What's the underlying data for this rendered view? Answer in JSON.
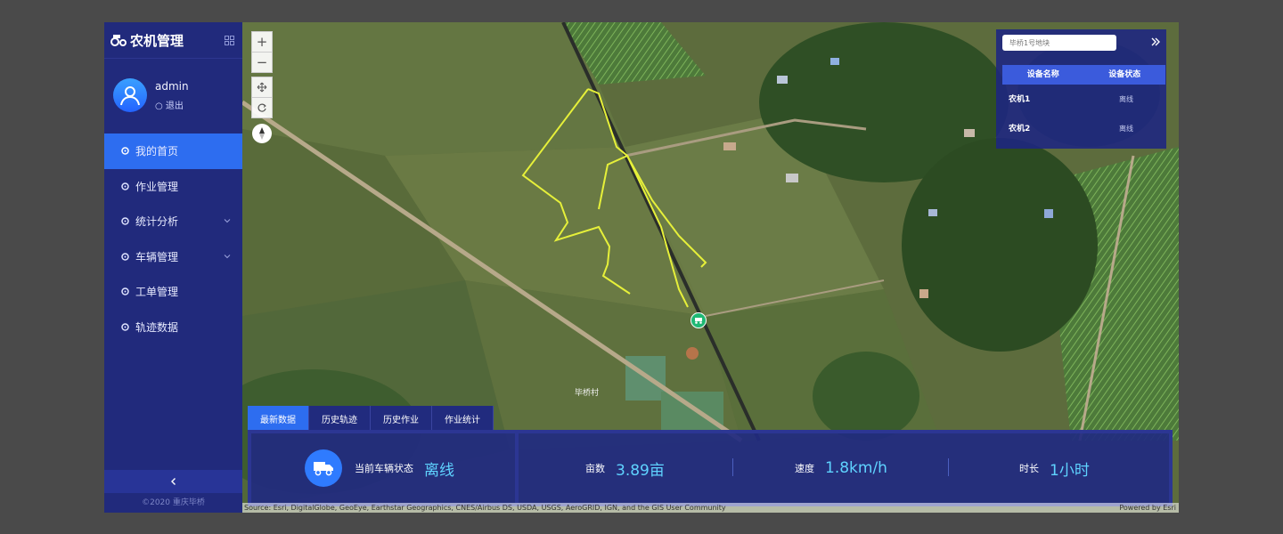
{
  "app": {
    "title": "农机管理"
  },
  "user": {
    "name": "admin",
    "logout": "退出"
  },
  "menu": [
    {
      "label": "我的首页",
      "active": true
    },
    {
      "label": "作业管理"
    },
    {
      "label": "统计分析",
      "has_sub": true
    },
    {
      "label": "车辆管理",
      "has_sub": true
    },
    {
      "label": "工单管理"
    },
    {
      "label": "轨迹数据"
    }
  ],
  "sidebar_footer": {
    "copyright": "©2020 重庆毕桥"
  },
  "map": {
    "place_label": "毕桥村",
    "attribution_left": "Source: Esri, DigitalGlobe, GeoEye, Earthstar Geographics, CNES/Airbus DS, USDA, USGS, AeroGRID, IGN, and the GIS User Community",
    "attribution_right": "Powered by Esri"
  },
  "device_panel": {
    "search_placeholder": "毕桥1号地块",
    "headers": [
      "设备名称",
      "设备状态"
    ],
    "rows": [
      {
        "name": "农机1",
        "status": "离线"
      },
      {
        "name": "农机2",
        "status": "离线"
      }
    ]
  },
  "tabs": [
    "最新数据",
    "历史轨迹",
    "历史作业",
    "作业统计"
  ],
  "info": {
    "status_label": "当前车辆状态",
    "status_value": "离线",
    "area_label": "亩数",
    "area_value": "3.89亩",
    "speed_label": "速度",
    "speed_value": "1.8km/h",
    "duration_label": "时长",
    "duration_value": "1小时"
  },
  "colors": {
    "sidebar": "#212a7c",
    "accent": "#2d6df0",
    "value": "#5fd3ff",
    "track": "#e6f03a"
  }
}
